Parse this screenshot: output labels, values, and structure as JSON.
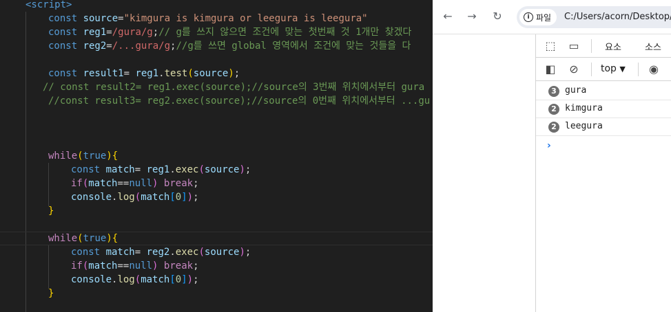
{
  "editor": {
    "lines": [
      [
        [
          "tag",
          "<script>"
        ]
      ],
      [
        [
          "kw",
          "const "
        ],
        [
          "var",
          "source"
        ],
        [
          "pl",
          "="
        ],
        [
          "str",
          "\"kimgura is kimgura or leegura is leegura\""
        ]
      ],
      [
        [
          "kw",
          "const "
        ],
        [
          "var",
          "reg1"
        ],
        [
          "pl",
          "="
        ],
        [
          "rx",
          "/gura/g"
        ],
        [
          "pl",
          ";"
        ],
        [
          "cm",
          "// g를 쓰지 않으면 조건에 맞는 첫번째 것 1개만 찾겠다"
        ]
      ],
      [
        [
          "kw",
          "const "
        ],
        [
          "var",
          "reg2"
        ],
        [
          "pl",
          "="
        ],
        [
          "rx",
          "/...gura/g"
        ],
        [
          "pl",
          ";"
        ],
        [
          "cm",
          "//g를 쓰면 global 영역에서 조건에 맞는 것들을 다"
        ]
      ],
      [],
      [
        [
          "kw",
          "const "
        ],
        [
          "var",
          "result1"
        ],
        [
          "pl",
          "= "
        ],
        [
          "var",
          "reg1"
        ],
        [
          "pl",
          "."
        ],
        [
          "fn",
          "test"
        ],
        [
          "br1",
          "("
        ],
        [
          "var",
          "source"
        ],
        [
          "br1",
          ")"
        ],
        [
          "pl",
          ";"
        ]
      ],
      [
        [
          "cm",
          "// const result2= reg1.exec(source);//source의 3번째 위치에서부터 gura"
        ]
      ],
      [
        [
          "cm",
          "//const result3= reg2.exec(source);//source의 0번째 위치에서부터 ...gu"
        ]
      ],
      [],
      [],
      [],
      [
        [
          "ctrl",
          "while"
        ],
        [
          "br1",
          "("
        ],
        [
          "kw",
          "true"
        ],
        [
          "br1",
          ")"
        ],
        [
          "br1",
          "{"
        ]
      ],
      [
        [
          "kw",
          "const "
        ],
        [
          "var",
          "match"
        ],
        [
          "pl",
          "= "
        ],
        [
          "var",
          "reg1"
        ],
        [
          "pl",
          "."
        ],
        [
          "fn",
          "exec"
        ],
        [
          "br2",
          "("
        ],
        [
          "var",
          "source"
        ],
        [
          "br2",
          ")"
        ],
        [
          "pl",
          ";"
        ]
      ],
      [
        [
          "ctrl",
          "if"
        ],
        [
          "br2",
          "("
        ],
        [
          "var",
          "match"
        ],
        [
          "pl",
          "=="
        ],
        [
          "kw",
          "null"
        ],
        [
          "br2",
          ")"
        ],
        [
          "pl",
          " "
        ],
        [
          "ctrl",
          "break"
        ],
        [
          "pl",
          ";"
        ]
      ],
      [
        [
          "var",
          "console"
        ],
        [
          "pl",
          "."
        ],
        [
          "fn",
          "log"
        ],
        [
          "br2",
          "("
        ],
        [
          "var",
          "match"
        ],
        [
          "br3",
          "["
        ],
        [
          "num",
          "0"
        ],
        [
          "br3",
          "]"
        ],
        [
          "br2",
          ")"
        ],
        [
          "pl",
          ";"
        ]
      ],
      [
        [
          "br1",
          "}"
        ]
      ],
      [],
      [
        [
          "ctrl",
          "while"
        ],
        [
          "br1",
          "("
        ],
        [
          "kw",
          "true"
        ],
        [
          "br1",
          ")"
        ],
        [
          "br1",
          "{"
        ]
      ],
      [
        [
          "kw",
          "const "
        ],
        [
          "var",
          "match"
        ],
        [
          "pl",
          "= "
        ],
        [
          "var",
          "reg2"
        ],
        [
          "pl",
          "."
        ],
        [
          "fn",
          "exec"
        ],
        [
          "br2",
          "("
        ],
        [
          "var",
          "source"
        ],
        [
          "br2",
          ")"
        ],
        [
          "pl",
          ";"
        ]
      ],
      [
        [
          "ctrl",
          "if"
        ],
        [
          "br2",
          "("
        ],
        [
          "var",
          "match"
        ],
        [
          "pl",
          "=="
        ],
        [
          "kw",
          "null"
        ],
        [
          "br2",
          ")"
        ],
        [
          "pl",
          " "
        ],
        [
          "ctrl",
          "break"
        ],
        [
          "pl",
          ";"
        ]
      ],
      [
        [
          "var",
          "console"
        ],
        [
          "pl",
          "."
        ],
        [
          "fn",
          "log"
        ],
        [
          "br2",
          "("
        ],
        [
          "var",
          "match"
        ],
        [
          "br3",
          "["
        ],
        [
          "num",
          "0"
        ],
        [
          "br3",
          "]"
        ],
        [
          "br2",
          ")"
        ],
        [
          "pl",
          ";"
        ]
      ],
      [
        [
          "br1",
          "}"
        ]
      ]
    ]
  },
  "browser": {
    "back_icon": "←",
    "forward_icon": "→",
    "reload_icon": "↻",
    "info_icon": "i",
    "info_label": "파일",
    "url": "C:/Users/acorn/Desktop/"
  },
  "devtools": {
    "inspect_icon": "⬚",
    "device_icon": "▭",
    "tab_elements": "요소",
    "tab_sources": "소스",
    "sidebar_icon": "◧",
    "clear_icon": "⊘",
    "context": "top",
    "context_arrow": "▼",
    "eye_icon": "◉",
    "logs": [
      {
        "count": "3",
        "text": "gura"
      },
      {
        "count": "2",
        "text": "kimgura"
      },
      {
        "count": "2",
        "text": "leegura"
      }
    ],
    "prompt": "›"
  }
}
